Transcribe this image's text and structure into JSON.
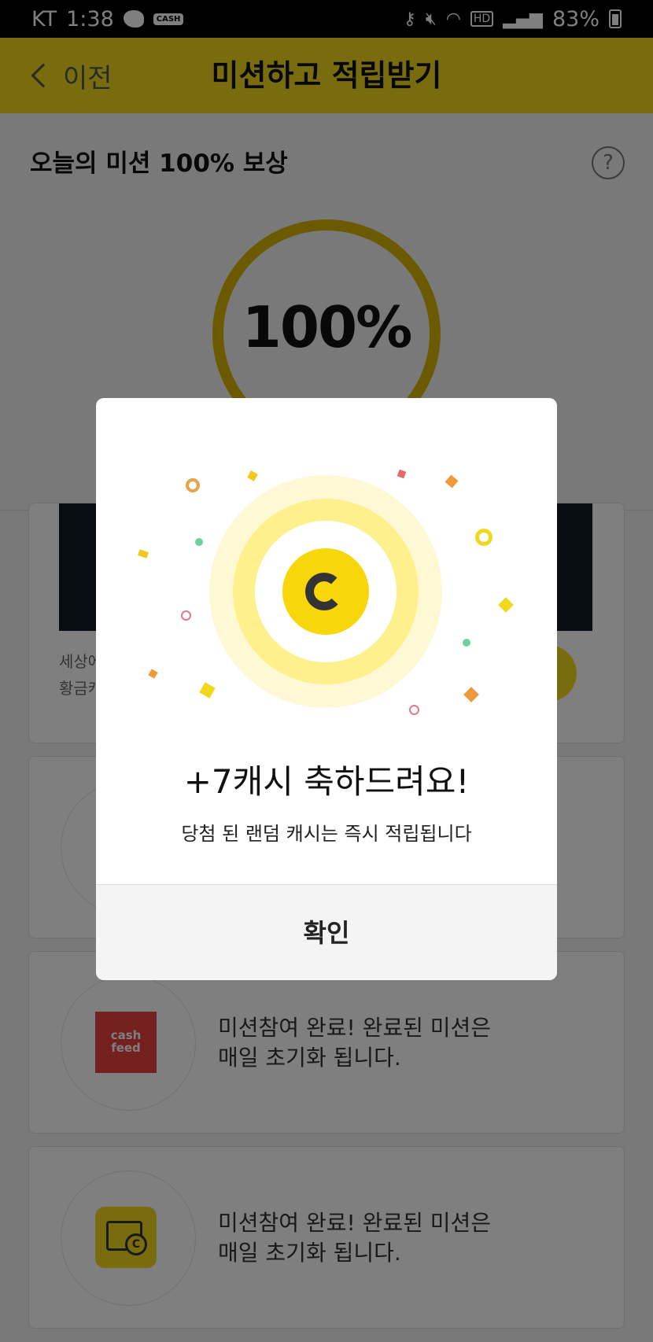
{
  "status_bar": {
    "carrier": "KT",
    "time": "1:38",
    "cash_badge": "CASH",
    "battery": "83%"
  },
  "header": {
    "back_label": "이전",
    "title": "미션하고 적립받기"
  },
  "mission": {
    "title": "오늘의 미션 100% 보상",
    "help": "?",
    "progress_label": "100%",
    "progress_value": 100
  },
  "cards": {
    "card1_desc_line1": "세상에",
    "card1_desc_line2": "황금캐",
    "card2_logo": "cash feed",
    "card2_text_line1": "미션참여 완료!  완료된 미션은",
    "card2_text_line2": "매일 초기화 됩니다.",
    "card3_coin": "C",
    "card3_text_line1": "미션참여 완료!  완료된 미션은",
    "card3_text_line2": "매일 초기화 됩니다."
  },
  "dialog": {
    "title": "+7캐시 축하드려요!",
    "subtitle": "당첨 된 랜덤 캐시는 즉시 적립됩니다",
    "confirm_label": "확인"
  },
  "colors": {
    "brand_yellow": "#f2d81d",
    "coin_yellow": "#f8d70a",
    "ring": "#d9b400"
  }
}
